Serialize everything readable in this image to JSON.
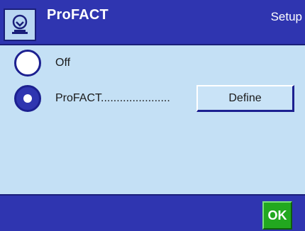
{
  "header": {
    "title": "ProFACT",
    "mode": "Setup",
    "icon": "balance-weight-icon"
  },
  "options": [
    {
      "label": "Off",
      "selected": false
    },
    {
      "label": "ProFACT......................",
      "selected": true
    }
  ],
  "define_button": {
    "label": "Define"
  },
  "footer": {
    "ok_label": "OK"
  },
  "colors": {
    "header_bg": "#2f35b0",
    "content_bg": "#c4e0f5",
    "ok_green": "#22a81f"
  }
}
